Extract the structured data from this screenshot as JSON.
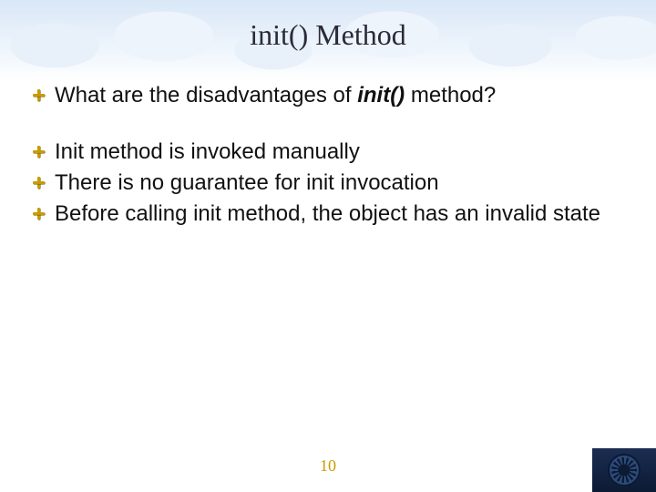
{
  "title": "init() Method",
  "question": {
    "pre": "What are the disadvantages of ",
    "em": "init()",
    "post": " method?"
  },
  "bullets": [
    "Init method is invoked manually",
    "There is no guarantee for init invocation",
    "Before calling init method, the object has an invalid state"
  ],
  "page_number": "10"
}
